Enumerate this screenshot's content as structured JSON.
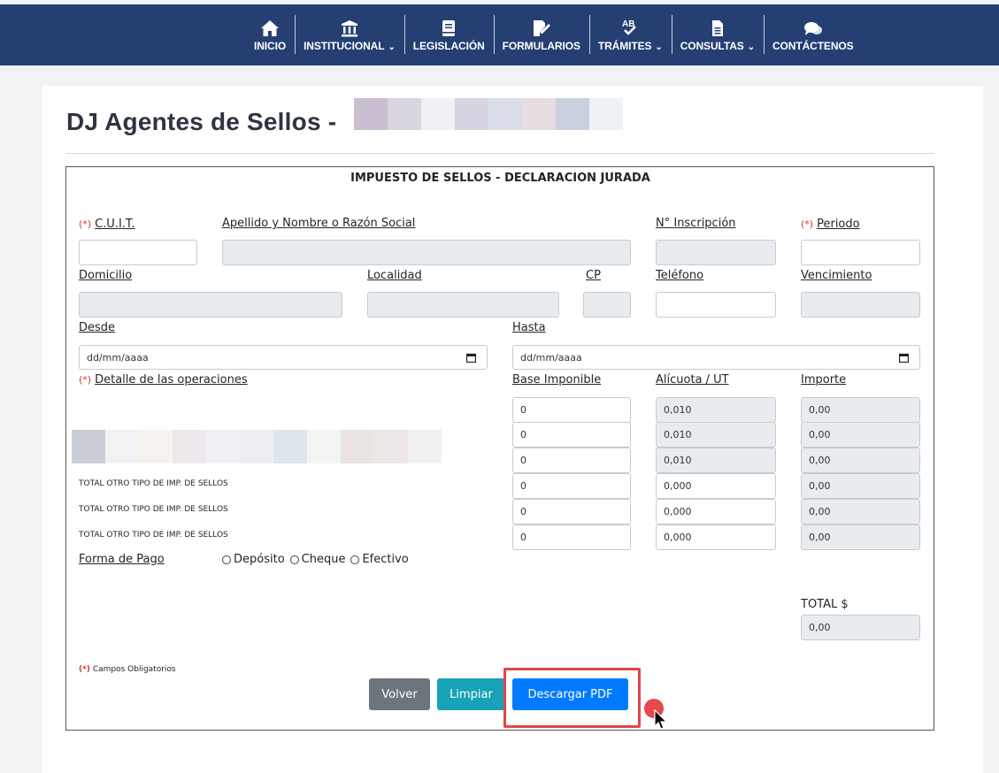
{
  "nav": [
    {
      "label": "INICIO",
      "icon": "home-icon",
      "dropdown": false
    },
    {
      "label": "INSTITUCIONAL",
      "icon": "institution-icon",
      "dropdown": true
    },
    {
      "label": "LEGISLACIÓN",
      "icon": "book-icon",
      "dropdown": false
    },
    {
      "label": "FORMULARIOS",
      "icon": "form-edit-icon",
      "dropdown": false
    },
    {
      "label": "TRÁMITES",
      "icon": "spellcheck-icon",
      "dropdown": true
    },
    {
      "label": "CONSULTAS",
      "icon": "document-icon",
      "dropdown": true
    },
    {
      "label": "CONTÁCTENOS",
      "icon": "chat-icon",
      "dropdown": false
    }
  ],
  "page": {
    "title": "DJ Agentes de Sellos -"
  },
  "form": {
    "title": "IMPUESTO DE SELLOS - DECLARACION JURADA",
    "required_mark": "(*)",
    "labels": {
      "cuit": "C.U.I.T.",
      "razon_social": "Apellido y Nombre o Razón Social",
      "inscripcion": "N° Inscripción",
      "periodo": "Periodo",
      "domicilio": "Domicilio",
      "localidad": "Localidad",
      "cp": "CP",
      "telefono": "Teléfono",
      "vencimiento": "Vencimiento",
      "desde": "Desde",
      "hasta": "Hasta",
      "detalle": "Detalle de las operaciones",
      "base": "Base Imponible",
      "alicuota": "Alícuota / UT",
      "importe": "Importe",
      "forma_pago": "Forma de Pago",
      "total": "TOTAL $",
      "campos_obligatorios": "Campos Obligatorios"
    },
    "date_placeholder": "dd/mm/aaaa",
    "other_label": "TOTAL OTRO TIPO DE IMP. DE SELLOS",
    "rows": [
      {
        "base": "0",
        "alicuota": "0,010",
        "importe": "0,00"
      },
      {
        "base": "0",
        "alicuota": "0,010",
        "importe": "0,00"
      },
      {
        "base": "0",
        "alicuota": "0,010",
        "importe": "0,00"
      },
      {
        "base": "0",
        "alicuota": "0,000",
        "importe": "0,00"
      },
      {
        "base": "0",
        "alicuota": "0,000",
        "importe": "0,00"
      },
      {
        "base": "0",
        "alicuota": "0,000",
        "importe": "0,00"
      }
    ],
    "payment_options": [
      "Depósito",
      "Cheque",
      "Efectivo"
    ],
    "total_value": "0,00"
  },
  "buttons": {
    "volver": "Volver",
    "limpiar": "Limpiar",
    "descargar": "Descargar PDF"
  },
  "colors": {
    "nav_bg": "#263f73",
    "volver": "#6c757d",
    "limpiar": "#17a2b8",
    "descargar": "#007bff",
    "highlight": "#e0464b",
    "required": "#d9342b"
  }
}
